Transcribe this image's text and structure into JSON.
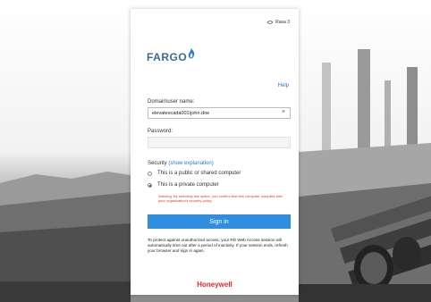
{
  "header": {
    "rdweb_label": "Rasa 3"
  },
  "brand": {
    "logo": "FARGO",
    "footer_logo": "Honeywell",
    "accent": "#2f8ee0",
    "danger": "#d33"
  },
  "links": {
    "help": "Help"
  },
  "form": {
    "domain_label": "Domain\\user name:",
    "domain_value": "elevatescada001\\john.doe",
    "clear_icon": "×",
    "password_label": "Password:",
    "password_value": ""
  },
  "security": {
    "label": "Security",
    "show_explanation": "(show explanation)",
    "options": [
      {
        "label": "This is a public or shared computer",
        "selected": false
      },
      {
        "label": "This is a private computer",
        "selected": true
      }
    ],
    "warning": "Warning: By selecting this option, you confirm that this computer complies with your organization's security policy."
  },
  "signin": {
    "label": "Sign in"
  },
  "info": {
    "text": "To protect against unauthorized access, your RD Web Access session will automatically time out after a period of inactivity. If your session ends, refresh your browser and sign in again."
  }
}
